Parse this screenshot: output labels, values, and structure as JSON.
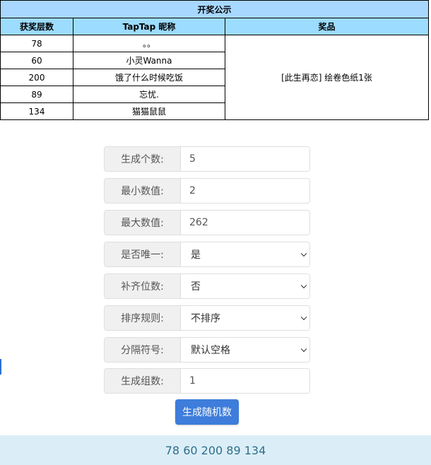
{
  "table": {
    "title": "开奖公示",
    "headers": [
      "获奖层数",
      "TapTap 昵称",
      "奖品"
    ],
    "rows": [
      {
        "floor": "78",
        "nickname": "。。"
      },
      {
        "floor": "60",
        "nickname": "小灵Wanna"
      },
      {
        "floor": "200",
        "nickname": "饿了什么时候吃饭"
      },
      {
        "floor": "89",
        "nickname": "忘忧."
      },
      {
        "floor": "134",
        "nickname": "猫猫鼠鼠"
      }
    ],
    "prize": "[此生再恋] 绘卷色纸1张"
  },
  "form": {
    "count": {
      "label": "生成个数:",
      "value": "5"
    },
    "min": {
      "label": "最小数值:",
      "value": "2"
    },
    "max": {
      "label": "最大数值:",
      "value": "262"
    },
    "unique": {
      "label": "是否唯一:",
      "value": "是"
    },
    "pad": {
      "label": "补齐位数:",
      "value": "否"
    },
    "sort": {
      "label": "排序规则:",
      "value": "不排序"
    },
    "separator": {
      "label": "分隔符号:",
      "value": "默认空格"
    },
    "groups": {
      "label": "生成组数:",
      "value": "1"
    }
  },
  "generate_button": "生成随机数",
  "result": "78 60 200 89 134"
}
